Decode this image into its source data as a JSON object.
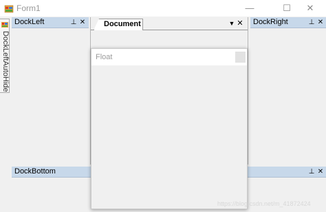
{
  "window": {
    "title": "Form1",
    "buttons": {
      "minimize": "—",
      "maximize": "☐",
      "close": "✕"
    }
  },
  "autohide": {
    "label": "DockLeftAutoHide"
  },
  "panes": {
    "left": {
      "title": "DockLeft",
      "pin": "⊥",
      "close": "✕"
    },
    "right": {
      "title": "DockRight",
      "pin": "⊥",
      "close": "✕"
    },
    "bottom": {
      "title": "DockBottom",
      "pin": "⊥",
      "close": "✕"
    }
  },
  "document": {
    "tab_label": "Document",
    "dropdown": "▼",
    "close": "✕"
  },
  "float": {
    "title": "Float"
  },
  "watermark": "https://blog.csdn.net/m_41872424",
  "colors": {
    "caption_bg": "#c7d8ea",
    "client_bg": "#f0f0f0",
    "title_text": "#999999"
  },
  "icons": {
    "app": "winforms-app-icon",
    "autohide": "winforms-app-icon",
    "pin": "pin-icon",
    "close": "close-icon",
    "dropdown": "dropdown-arrow-icon"
  }
}
